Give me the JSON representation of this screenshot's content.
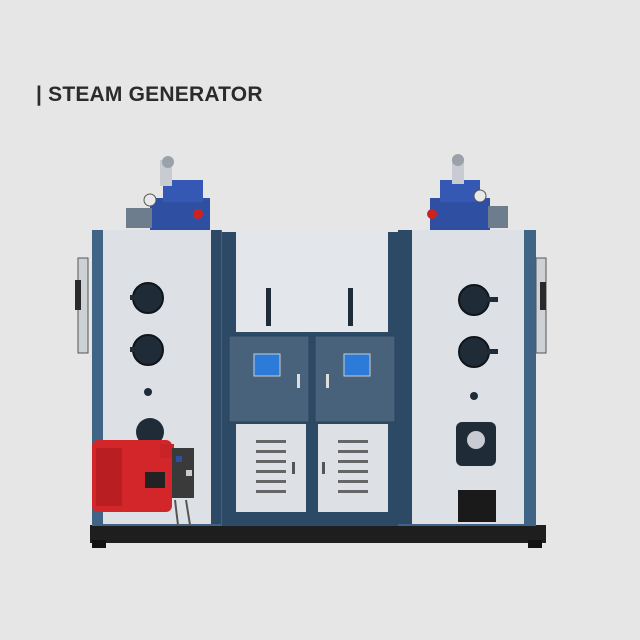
{
  "heading": {
    "text": "| STEAM GENERATOR"
  },
  "product_image": {
    "subject": "steam-generator-machine",
    "colors": {
      "frame": "#3f6485",
      "frame_dark": "#2c4a66",
      "panel": "#d9dde2",
      "panel_light": "#e3e6ea",
      "control_panel": "#49627c",
      "burner": "#d3262a",
      "valves": "#2f4fa3",
      "base": "#1e1e1e"
    }
  }
}
